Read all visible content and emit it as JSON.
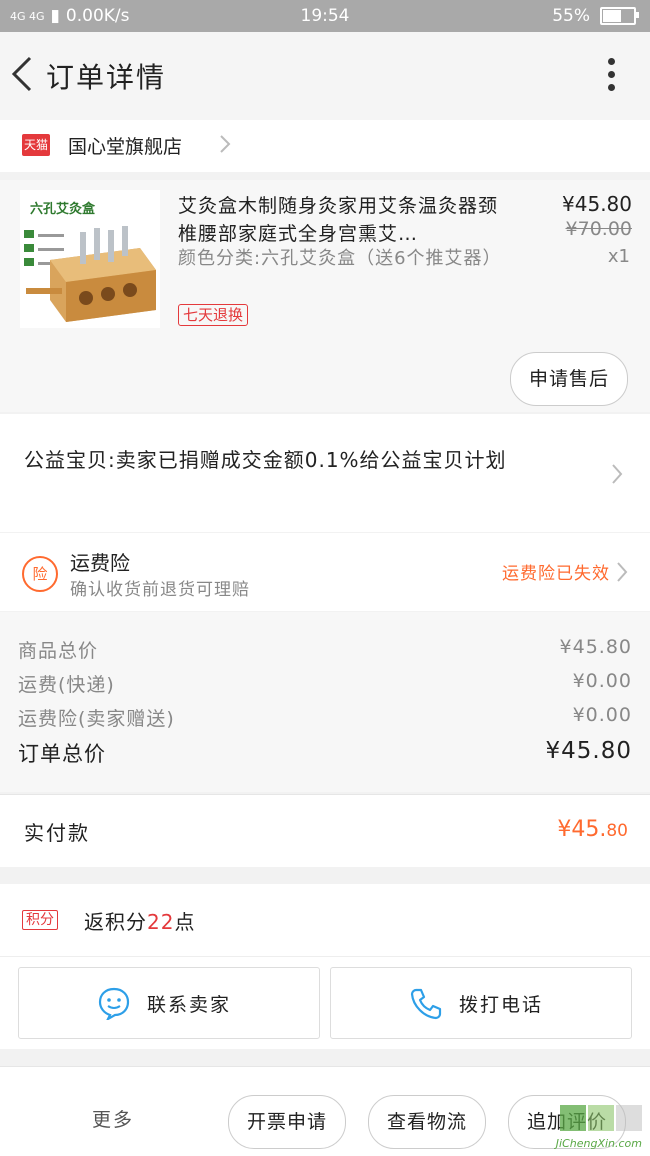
{
  "status_bar": {
    "network": "4G 4G",
    "speed": "0.00K/s",
    "time": "19:54",
    "battery": "55%"
  },
  "nav": {
    "title": "订单详情"
  },
  "store": {
    "badge": "天猫",
    "name": "国心堂旗舰店"
  },
  "product": {
    "image_label": "六孔艾灸盒",
    "title": "艾灸盒木制随身灸家用艾条温灸器颈椎腰部家庭式全身宫熏艾…",
    "spec": "颜色分类:六孔艾灸盒（送6个推艾器）",
    "badge": "七天退换",
    "price": "¥45.80",
    "original_price": "¥70.00",
    "quantity": "x1",
    "after_sale_button": "申请售后"
  },
  "charity": {
    "text": "公益宝贝:卖家已捐赠成交金额0.1%给公益宝贝计划"
  },
  "insurance": {
    "icon": "险",
    "title": "运费险",
    "subtitle": "确认收货前退货可理赔",
    "status": "运费险已失效"
  },
  "summary": {
    "rows": [
      {
        "label": "商品总价",
        "value": "¥45.80"
      },
      {
        "label": "运费(快递)",
        "value": "¥0.00"
      },
      {
        "label": "运费险(卖家赠送)",
        "value": "¥0.00"
      }
    ],
    "total_label": "订单总价",
    "total_value": "¥45.80"
  },
  "paid": {
    "label": "实付款",
    "value_main": "¥45.",
    "value_cents": "80"
  },
  "points": {
    "badge": "积分",
    "prefix": "返积分",
    "count": "22",
    "suffix": "点"
  },
  "contact": {
    "seller_label": "联系卖家",
    "phone_label": "拨打电话"
  },
  "bottom": {
    "more": "更多",
    "buttons": [
      "开票申请",
      "查看物流",
      "追加评价"
    ]
  },
  "watermark": {
    "text": "JiChengXin.com"
  },
  "colors": {
    "accent": "#ff6a2f",
    "tmall_red": "#e4393c",
    "blue_icon": "#2d9fe8"
  }
}
